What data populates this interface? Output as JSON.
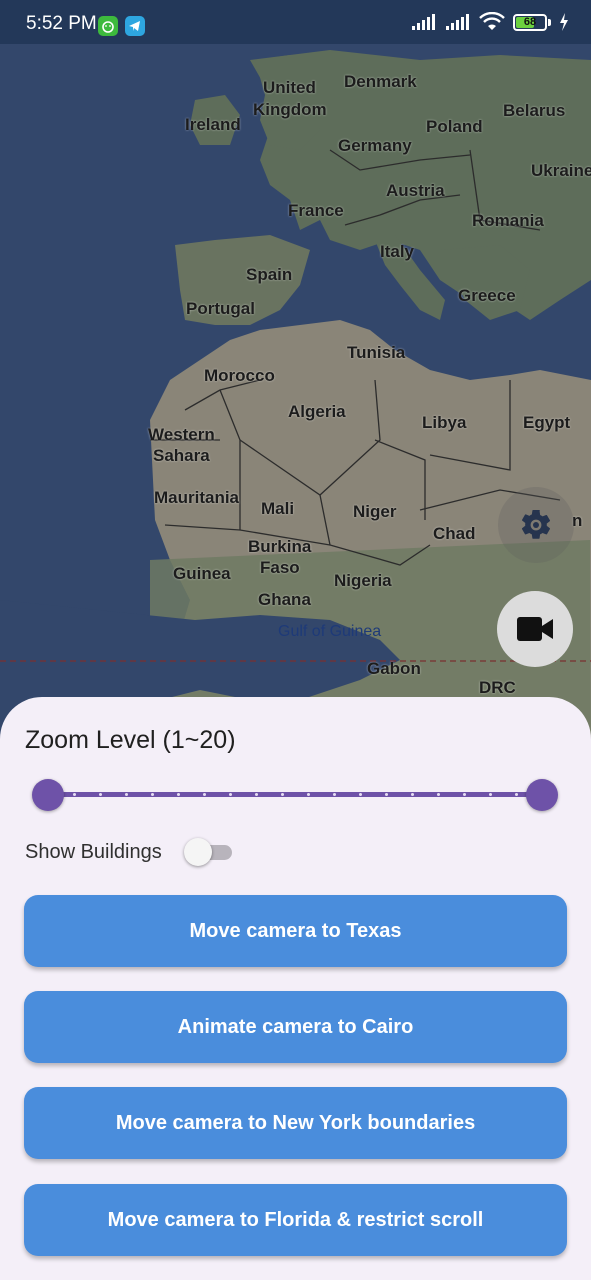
{
  "status_bar": {
    "time": "5:52 PM",
    "battery_level": "68",
    "battery_fraction": 0.68,
    "icons": [
      "android-app-icon",
      "telegram-icon",
      "signal-icon",
      "signal-icon",
      "wifi-icon",
      "battery-icon",
      "charging-icon"
    ]
  },
  "map": {
    "labels": {
      "ireland": "Ireland",
      "united_kingdom_1": "United",
      "united_kingdom_2": "Kingdom",
      "denmark": "Denmark",
      "belarus": "Belarus",
      "poland": "Poland",
      "germany": "Germany",
      "ukraine": "Ukraine",
      "austria": "Austria",
      "france": "France",
      "romania": "Romania",
      "italy": "Italy",
      "spain": "Spain",
      "portugal": "Portugal",
      "greece": "Greece",
      "tunisia": "Tunisia",
      "morocco": "Morocco",
      "algeria": "Algeria",
      "libya": "Libya",
      "egypt": "Egypt",
      "western_sahara_1": "Western",
      "western_sahara_2": "Sahara",
      "mauritania": "Mauritania",
      "mali": "Mali",
      "niger": "Niger",
      "chad": "Chad",
      "sudan_fragment": "n",
      "burkina_1": "Burkina",
      "burkina_2": "Faso",
      "guinea": "Guinea",
      "nigeria": "Nigeria",
      "ghana": "Ghana",
      "gulf_of_guinea": "Gulf of Guinea",
      "gabon": "Gabon",
      "drc": "DRC"
    },
    "colors": {
      "water": "#33476b",
      "land": "#6f7668",
      "desert": "#8a8578",
      "border": "#2c2c2c"
    }
  },
  "controls": {
    "settings_icon": "gear-icon",
    "camera_icon": "video-camera-icon"
  },
  "sheet": {
    "zoom_title": "Zoom Level (1~20)",
    "zoom_range": [
      1,
      20
    ],
    "zoom_selected": [
      1,
      20
    ],
    "show_buildings_label": "Show Buildings",
    "show_buildings_on": false,
    "buttons": [
      {
        "label": "Move camera to Texas"
      },
      {
        "label": "Animate camera to Cairo"
      },
      {
        "label": "Move camera to New York boundaries"
      },
      {
        "label": "Move camera to Florida & restrict scroll"
      }
    ],
    "accent_color": "#6e52a8",
    "button_color": "#4a8ddc"
  }
}
